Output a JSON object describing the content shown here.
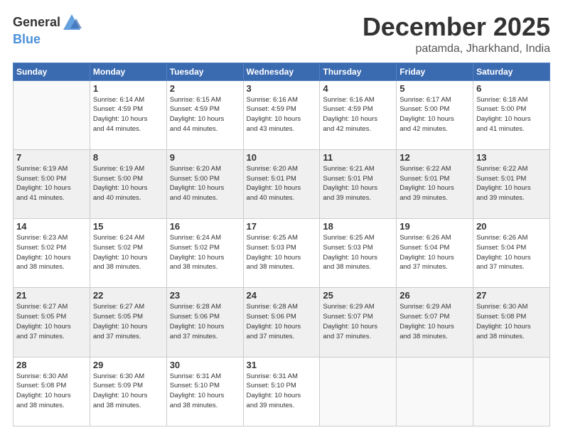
{
  "logo": {
    "general": "General",
    "blue": "Blue"
  },
  "header": {
    "month": "December 2025",
    "location": "patamda, Jharkhand, India"
  },
  "weekdays": [
    "Sunday",
    "Monday",
    "Tuesday",
    "Wednesday",
    "Thursday",
    "Friday",
    "Saturday"
  ],
  "weeks": [
    [
      {
        "day": "",
        "info": ""
      },
      {
        "day": "1",
        "info": "Sunrise: 6:14 AM\nSunset: 4:59 PM\nDaylight: 10 hours\nand 44 minutes."
      },
      {
        "day": "2",
        "info": "Sunrise: 6:15 AM\nSunset: 4:59 PM\nDaylight: 10 hours\nand 44 minutes."
      },
      {
        "day": "3",
        "info": "Sunrise: 6:16 AM\nSunset: 4:59 PM\nDaylight: 10 hours\nand 43 minutes."
      },
      {
        "day": "4",
        "info": "Sunrise: 6:16 AM\nSunset: 4:59 PM\nDaylight: 10 hours\nand 42 minutes."
      },
      {
        "day": "5",
        "info": "Sunrise: 6:17 AM\nSunset: 5:00 PM\nDaylight: 10 hours\nand 42 minutes."
      },
      {
        "day": "6",
        "info": "Sunrise: 6:18 AM\nSunset: 5:00 PM\nDaylight: 10 hours\nand 41 minutes."
      }
    ],
    [
      {
        "day": "7",
        "info": "Sunrise: 6:19 AM\nSunset: 5:00 PM\nDaylight: 10 hours\nand 41 minutes."
      },
      {
        "day": "8",
        "info": "Sunrise: 6:19 AM\nSunset: 5:00 PM\nDaylight: 10 hours\nand 40 minutes."
      },
      {
        "day": "9",
        "info": "Sunrise: 6:20 AM\nSunset: 5:00 PM\nDaylight: 10 hours\nand 40 minutes."
      },
      {
        "day": "10",
        "info": "Sunrise: 6:20 AM\nSunset: 5:01 PM\nDaylight: 10 hours\nand 40 minutes."
      },
      {
        "day": "11",
        "info": "Sunrise: 6:21 AM\nSunset: 5:01 PM\nDaylight: 10 hours\nand 39 minutes."
      },
      {
        "day": "12",
        "info": "Sunrise: 6:22 AM\nSunset: 5:01 PM\nDaylight: 10 hours\nand 39 minutes."
      },
      {
        "day": "13",
        "info": "Sunrise: 6:22 AM\nSunset: 5:01 PM\nDaylight: 10 hours\nand 39 minutes."
      }
    ],
    [
      {
        "day": "14",
        "info": "Sunrise: 6:23 AM\nSunset: 5:02 PM\nDaylight: 10 hours\nand 38 minutes."
      },
      {
        "day": "15",
        "info": "Sunrise: 6:24 AM\nSunset: 5:02 PM\nDaylight: 10 hours\nand 38 minutes."
      },
      {
        "day": "16",
        "info": "Sunrise: 6:24 AM\nSunset: 5:02 PM\nDaylight: 10 hours\nand 38 minutes."
      },
      {
        "day": "17",
        "info": "Sunrise: 6:25 AM\nSunset: 5:03 PM\nDaylight: 10 hours\nand 38 minutes."
      },
      {
        "day": "18",
        "info": "Sunrise: 6:25 AM\nSunset: 5:03 PM\nDaylight: 10 hours\nand 38 minutes."
      },
      {
        "day": "19",
        "info": "Sunrise: 6:26 AM\nSunset: 5:04 PM\nDaylight: 10 hours\nand 37 minutes."
      },
      {
        "day": "20",
        "info": "Sunrise: 6:26 AM\nSunset: 5:04 PM\nDaylight: 10 hours\nand 37 minutes."
      }
    ],
    [
      {
        "day": "21",
        "info": "Sunrise: 6:27 AM\nSunset: 5:05 PM\nDaylight: 10 hours\nand 37 minutes."
      },
      {
        "day": "22",
        "info": "Sunrise: 6:27 AM\nSunset: 5:05 PM\nDaylight: 10 hours\nand 37 minutes."
      },
      {
        "day": "23",
        "info": "Sunrise: 6:28 AM\nSunset: 5:06 PM\nDaylight: 10 hours\nand 37 minutes."
      },
      {
        "day": "24",
        "info": "Sunrise: 6:28 AM\nSunset: 5:06 PM\nDaylight: 10 hours\nand 37 minutes."
      },
      {
        "day": "25",
        "info": "Sunrise: 6:29 AM\nSunset: 5:07 PM\nDaylight: 10 hours\nand 37 minutes."
      },
      {
        "day": "26",
        "info": "Sunrise: 6:29 AM\nSunset: 5:07 PM\nDaylight: 10 hours\nand 38 minutes."
      },
      {
        "day": "27",
        "info": "Sunrise: 6:30 AM\nSunset: 5:08 PM\nDaylight: 10 hours\nand 38 minutes."
      }
    ],
    [
      {
        "day": "28",
        "info": "Sunrise: 6:30 AM\nSunset: 5:08 PM\nDaylight: 10 hours\nand 38 minutes."
      },
      {
        "day": "29",
        "info": "Sunrise: 6:30 AM\nSunset: 5:09 PM\nDaylight: 10 hours\nand 38 minutes."
      },
      {
        "day": "30",
        "info": "Sunrise: 6:31 AM\nSunset: 5:10 PM\nDaylight: 10 hours\nand 38 minutes."
      },
      {
        "day": "31",
        "info": "Sunrise: 6:31 AM\nSunset: 5:10 PM\nDaylight: 10 hours\nand 39 minutes."
      },
      {
        "day": "",
        "info": ""
      },
      {
        "day": "",
        "info": ""
      },
      {
        "day": "",
        "info": ""
      }
    ]
  ]
}
